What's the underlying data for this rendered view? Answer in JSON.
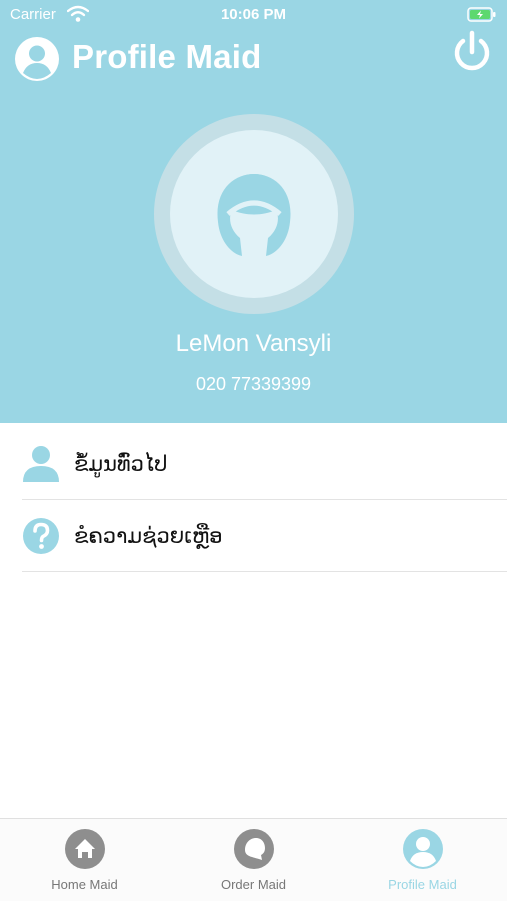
{
  "status_bar": {
    "carrier": "Carrier",
    "time": "10:06 PM"
  },
  "header": {
    "title": "Profile Maid"
  },
  "profile": {
    "name": "LeMon Vansyli",
    "phone": "020 77339399"
  },
  "menu": [
    {
      "label": "ຂໍ້ມູນທົ່ວໄປ",
      "icon": "person-icon"
    },
    {
      "label": "ຂໍຄວາມຊ່ວຍເຫຼືອ",
      "icon": "help-icon"
    }
  ],
  "tabs": [
    {
      "label": "Home Maid",
      "icon": "home-icon",
      "active": false
    },
    {
      "label": "Order Maid",
      "icon": "order-icon",
      "active": false
    },
    {
      "label": "Profile Maid",
      "icon": "profile-icon",
      "active": true
    }
  ],
  "colors": {
    "accent": "#9AD6E4",
    "inactive_tab": "#777777",
    "divider": "#E3E3E3"
  }
}
